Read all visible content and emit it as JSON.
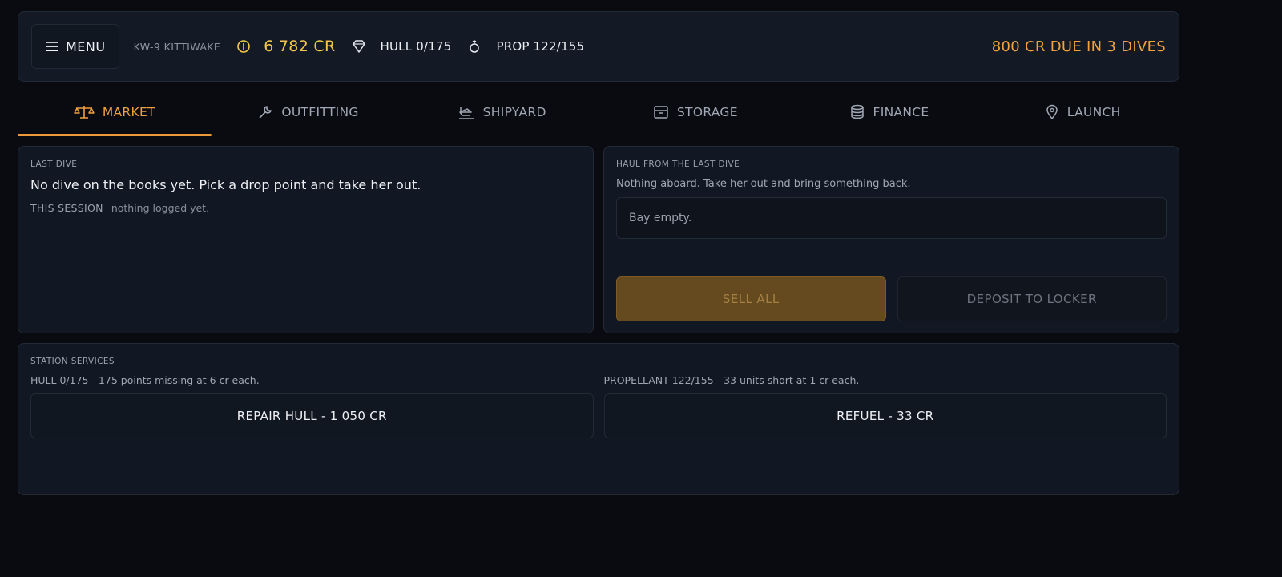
{
  "header": {
    "menu_label": "MENU",
    "ship_name": "KW-9 KITTIWAKE",
    "credits": "6 782 CR",
    "hull": "HULL 0/175",
    "prop": "PROP 122/155",
    "debt_notice": "800 CR DUE IN 3 DIVES",
    "icons": [
      "menu-icon",
      "coin-icon",
      "shield-icon",
      "fuel-drop-icon"
    ]
  },
  "tabs": [
    {
      "label": "MARKET",
      "icon": "scales-icon",
      "active": true
    },
    {
      "label": "OUTFITTING",
      "icon": "wrench-icon",
      "active": false
    },
    {
      "label": "SHIPYARD",
      "icon": "ship-icon",
      "active": false
    },
    {
      "label": "STORAGE",
      "icon": "crate-icon",
      "active": false
    },
    {
      "label": "FINANCE",
      "icon": "coins-stack-icon",
      "active": false
    },
    {
      "label": "LAUNCH",
      "icon": "map-pin-icon",
      "active": false
    }
  ],
  "last_dive": {
    "title": "LAST DIVE",
    "headline": "No dive on the books yet. Pick a drop point and take her out.",
    "session_label": "THIS SESSION",
    "session_text": "nothing logged yet."
  },
  "haul": {
    "title": "HAUL FROM THE LAST DIVE",
    "subtitle": "Nothing aboard. Take her out and bring something back.",
    "bay_text": "Bay empty.",
    "sell_label": "SELL ALL",
    "deposit_label": "DEPOSIT TO LOCKER"
  },
  "services": {
    "title": "STATION SERVICES",
    "hull_note": "HULL 0/175 - 175 points missing at 6 cr each.",
    "repair_label": "REPAIR HULL - 1 050 CR",
    "prop_note": "PROPELLANT 122/155 - 33 units short at 1 cr each.",
    "refuel_label": "REFUEL - 33 CR"
  },
  "colors": {
    "accent": "#f0a040",
    "credits": "#f5c84a",
    "background": "#090b10",
    "panel": "#121823"
  }
}
